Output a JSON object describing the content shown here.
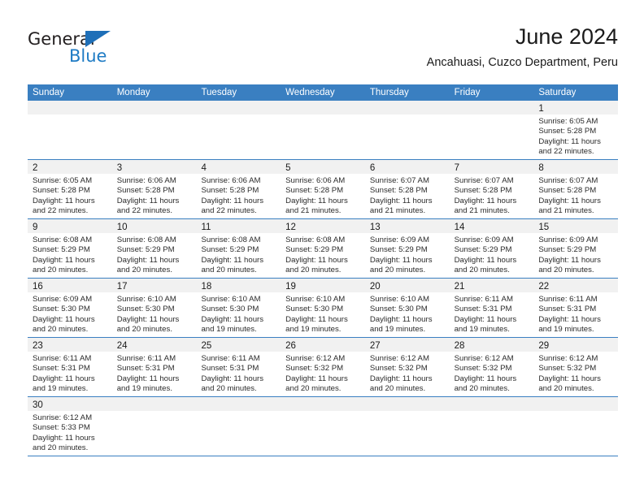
{
  "brand": {
    "name_dark": "General",
    "name_light": "Blue",
    "accent_color": "#1e7bc4"
  },
  "header": {
    "title": "June 2024",
    "subtitle": "Ancahuasi, Cuzco Department, Peru"
  },
  "colors": {
    "header_bar": "#3a7fc1",
    "day_strip": "#f1f1f1",
    "cell_border": "#3a7fc1",
    "text": "#1a1a1a"
  },
  "weekdays": [
    "Sunday",
    "Monday",
    "Tuesday",
    "Wednesday",
    "Thursday",
    "Friday",
    "Saturday"
  ],
  "weeks": [
    [
      {
        "day": "",
        "lines": []
      },
      {
        "day": "",
        "lines": []
      },
      {
        "day": "",
        "lines": []
      },
      {
        "day": "",
        "lines": []
      },
      {
        "day": "",
        "lines": []
      },
      {
        "day": "",
        "lines": []
      },
      {
        "day": "1",
        "lines": [
          "Sunrise: 6:05 AM",
          "Sunset: 5:28 PM",
          "Daylight: 11 hours",
          "and 22 minutes."
        ]
      }
    ],
    [
      {
        "day": "2",
        "lines": [
          "Sunrise: 6:05 AM",
          "Sunset: 5:28 PM",
          "Daylight: 11 hours",
          "and 22 minutes."
        ]
      },
      {
        "day": "3",
        "lines": [
          "Sunrise: 6:06 AM",
          "Sunset: 5:28 PM",
          "Daylight: 11 hours",
          "and 22 minutes."
        ]
      },
      {
        "day": "4",
        "lines": [
          "Sunrise: 6:06 AM",
          "Sunset: 5:28 PM",
          "Daylight: 11 hours",
          "and 22 minutes."
        ]
      },
      {
        "day": "5",
        "lines": [
          "Sunrise: 6:06 AM",
          "Sunset: 5:28 PM",
          "Daylight: 11 hours",
          "and 21 minutes."
        ]
      },
      {
        "day": "6",
        "lines": [
          "Sunrise: 6:07 AM",
          "Sunset: 5:28 PM",
          "Daylight: 11 hours",
          "and 21 minutes."
        ]
      },
      {
        "day": "7",
        "lines": [
          "Sunrise: 6:07 AM",
          "Sunset: 5:28 PM",
          "Daylight: 11 hours",
          "and 21 minutes."
        ]
      },
      {
        "day": "8",
        "lines": [
          "Sunrise: 6:07 AM",
          "Sunset: 5:28 PM",
          "Daylight: 11 hours",
          "and 21 minutes."
        ]
      }
    ],
    [
      {
        "day": "9",
        "lines": [
          "Sunrise: 6:08 AM",
          "Sunset: 5:29 PM",
          "Daylight: 11 hours",
          "and 20 minutes."
        ]
      },
      {
        "day": "10",
        "lines": [
          "Sunrise: 6:08 AM",
          "Sunset: 5:29 PM",
          "Daylight: 11 hours",
          "and 20 minutes."
        ]
      },
      {
        "day": "11",
        "lines": [
          "Sunrise: 6:08 AM",
          "Sunset: 5:29 PM",
          "Daylight: 11 hours",
          "and 20 minutes."
        ]
      },
      {
        "day": "12",
        "lines": [
          "Sunrise: 6:08 AM",
          "Sunset: 5:29 PM",
          "Daylight: 11 hours",
          "and 20 minutes."
        ]
      },
      {
        "day": "13",
        "lines": [
          "Sunrise: 6:09 AM",
          "Sunset: 5:29 PM",
          "Daylight: 11 hours",
          "and 20 minutes."
        ]
      },
      {
        "day": "14",
        "lines": [
          "Sunrise: 6:09 AM",
          "Sunset: 5:29 PM",
          "Daylight: 11 hours",
          "and 20 minutes."
        ]
      },
      {
        "day": "15",
        "lines": [
          "Sunrise: 6:09 AM",
          "Sunset: 5:29 PM",
          "Daylight: 11 hours",
          "and 20 minutes."
        ]
      }
    ],
    [
      {
        "day": "16",
        "lines": [
          "Sunrise: 6:09 AM",
          "Sunset: 5:30 PM",
          "Daylight: 11 hours",
          "and 20 minutes."
        ]
      },
      {
        "day": "17",
        "lines": [
          "Sunrise: 6:10 AM",
          "Sunset: 5:30 PM",
          "Daylight: 11 hours",
          "and 20 minutes."
        ]
      },
      {
        "day": "18",
        "lines": [
          "Sunrise: 6:10 AM",
          "Sunset: 5:30 PM",
          "Daylight: 11 hours",
          "and 19 minutes."
        ]
      },
      {
        "day": "19",
        "lines": [
          "Sunrise: 6:10 AM",
          "Sunset: 5:30 PM",
          "Daylight: 11 hours",
          "and 19 minutes."
        ]
      },
      {
        "day": "20",
        "lines": [
          "Sunrise: 6:10 AM",
          "Sunset: 5:30 PM",
          "Daylight: 11 hours",
          "and 19 minutes."
        ]
      },
      {
        "day": "21",
        "lines": [
          "Sunrise: 6:11 AM",
          "Sunset: 5:31 PM",
          "Daylight: 11 hours",
          "and 19 minutes."
        ]
      },
      {
        "day": "22",
        "lines": [
          "Sunrise: 6:11 AM",
          "Sunset: 5:31 PM",
          "Daylight: 11 hours",
          "and 19 minutes."
        ]
      }
    ],
    [
      {
        "day": "23",
        "lines": [
          "Sunrise: 6:11 AM",
          "Sunset: 5:31 PM",
          "Daylight: 11 hours",
          "and 19 minutes."
        ]
      },
      {
        "day": "24",
        "lines": [
          "Sunrise: 6:11 AM",
          "Sunset: 5:31 PM",
          "Daylight: 11 hours",
          "and 19 minutes."
        ]
      },
      {
        "day": "25",
        "lines": [
          "Sunrise: 6:11 AM",
          "Sunset: 5:31 PM",
          "Daylight: 11 hours",
          "and 20 minutes."
        ]
      },
      {
        "day": "26",
        "lines": [
          "Sunrise: 6:12 AM",
          "Sunset: 5:32 PM",
          "Daylight: 11 hours",
          "and 20 minutes."
        ]
      },
      {
        "day": "27",
        "lines": [
          "Sunrise: 6:12 AM",
          "Sunset: 5:32 PM",
          "Daylight: 11 hours",
          "and 20 minutes."
        ]
      },
      {
        "day": "28",
        "lines": [
          "Sunrise: 6:12 AM",
          "Sunset: 5:32 PM",
          "Daylight: 11 hours",
          "and 20 minutes."
        ]
      },
      {
        "day": "29",
        "lines": [
          "Sunrise: 6:12 AM",
          "Sunset: 5:32 PM",
          "Daylight: 11 hours",
          "and 20 minutes."
        ]
      }
    ],
    [
      {
        "day": "30",
        "lines": [
          "Sunrise: 6:12 AM",
          "Sunset: 5:33 PM",
          "Daylight: 11 hours",
          "and 20 minutes."
        ]
      },
      {
        "day": "",
        "lines": []
      },
      {
        "day": "",
        "lines": []
      },
      {
        "day": "",
        "lines": []
      },
      {
        "day": "",
        "lines": []
      },
      {
        "day": "",
        "lines": []
      },
      {
        "day": "",
        "lines": []
      }
    ]
  ]
}
